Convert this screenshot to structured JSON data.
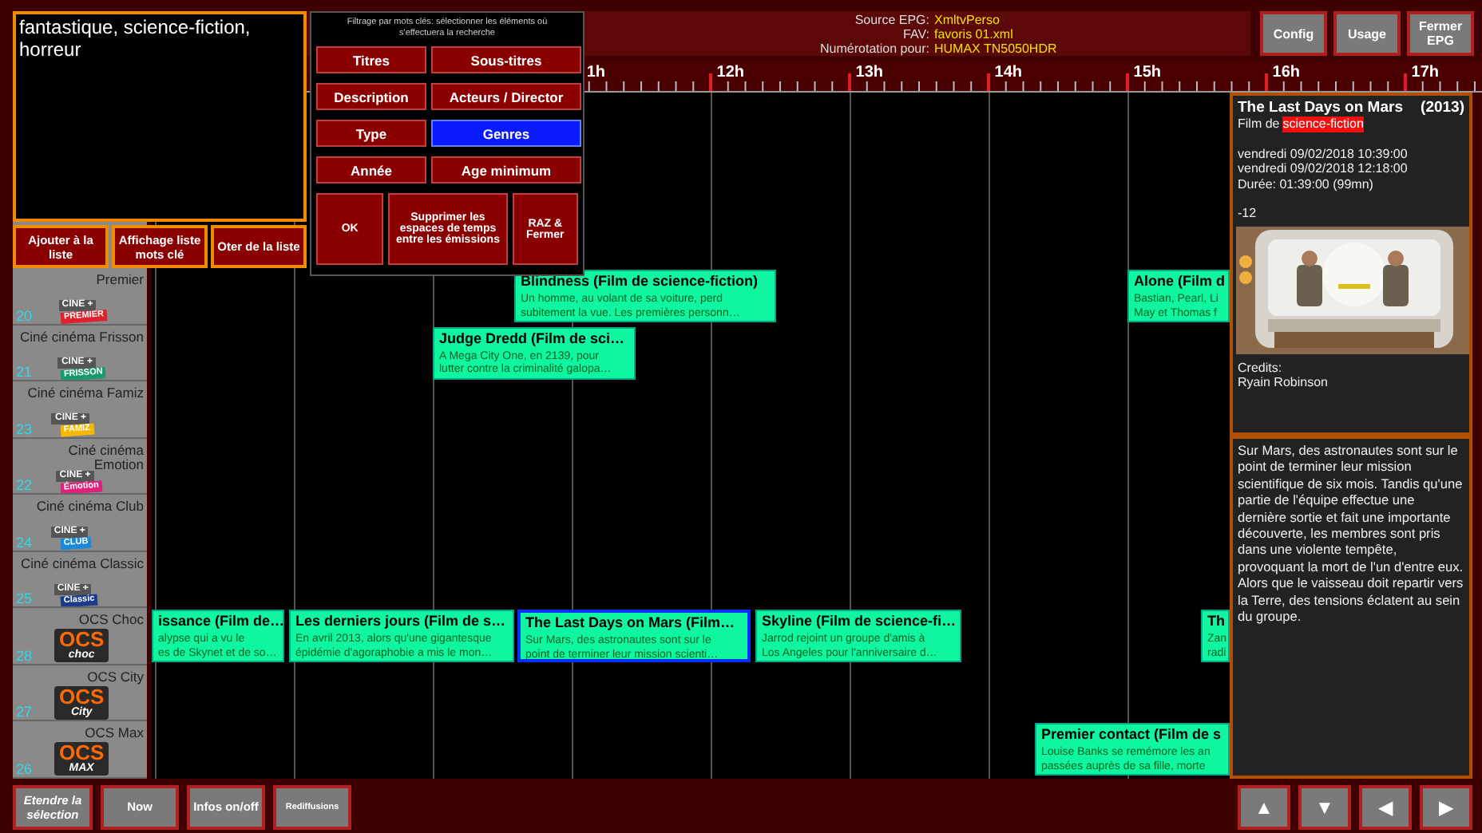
{
  "header": {
    "info": [
      {
        "label": "Source EPG:",
        "value": "XmltvPerso"
      },
      {
        "label": "FAV:",
        "value": "favoris 01.xml"
      },
      {
        "label": "Numérotation pour:",
        "value": "HUMAX TN5050HDR"
      }
    ],
    "buttons": [
      "Config",
      "Usage",
      "Fermer EPG"
    ]
  },
  "keyword_panel": {
    "text": "fantastique, science-fiction, horreur",
    "buttons": [
      "Ajouter à la liste",
      "Affichage liste mots clé",
      "Oter de la liste"
    ]
  },
  "filter_popup": {
    "title": "Filtrage par mots clés: sélectionner les éléments où s'effectuera la recherche",
    "fields": [
      {
        "label": "Titres",
        "selected": false
      },
      {
        "label": "Sous-titres",
        "selected": false
      },
      {
        "label": "Description",
        "selected": false
      },
      {
        "label": "Acteurs / Director",
        "selected": false
      },
      {
        "label": "Type",
        "selected": false
      },
      {
        "label": "Genres",
        "selected": true
      },
      {
        "label": "Année",
        "selected": false
      },
      {
        "label": "Age minimum",
        "selected": false
      }
    ],
    "actions": [
      "OK",
      "Supprimer les espaces de temps entre les émissions",
      "RAZ & Fermer"
    ]
  },
  "timeline": {
    "hours": [
      "1h",
      "12h",
      "13h",
      "14h",
      "15h",
      "16h",
      "17h"
    ]
  },
  "channels": [
    {
      "name": "Premier",
      "number": "20",
      "logo": {
        "kind": "cine",
        "top": "CINE +",
        "tag": "PREMIER",
        "color": "#e0202a"
      },
      "programs": [
        {
          "title": "Blindness (Film de science-fiction)",
          "description": "Un homme, au volant de sa voiture, perd\nsubitement la vue. Les premières personn…",
          "selected": false
        },
        {
          "title": "Alone (Film d",
          "description": "Bastian, Pearl, Li\nMay et Thomas f",
          "selected": false
        }
      ]
    },
    {
      "name": "Ciné cinéma Frisson",
      "number": "21",
      "logo": {
        "kind": "cine",
        "top": "CINE +",
        "tag": "FRISSON",
        "color": "#1a9a6a"
      },
      "programs": [
        {
          "title": "Judge Dredd (Film de sci…",
          "description": "A Mega City One, en 2139, pour\nlutter contre la criminalité galopa…",
          "selected": false
        }
      ]
    },
    {
      "name": "Ciné cinéma Famiz",
      "number": "23",
      "logo": {
        "kind": "cine",
        "top": "CINE +",
        "tag": "FAMIZ",
        "color": "#f5b800"
      }
    },
    {
      "name": "Ciné cinéma Emotion",
      "number": "22",
      "logo": {
        "kind": "cine",
        "top": "CINE +",
        "tag": "Émotion",
        "color": "#e0207a"
      }
    },
    {
      "name": "Ciné cinéma Club",
      "number": "24",
      "logo": {
        "kind": "cine",
        "top": "CINE +",
        "tag": "CLUB",
        "color": "#1a8ad8"
      }
    },
    {
      "name": "Ciné cinéma Classic",
      "number": "25",
      "logo": {
        "kind": "cine",
        "top": "CINE +",
        "tag": "Classic",
        "color": "#1a3a8a"
      }
    },
    {
      "name": "OCS Choc",
      "number": "28",
      "logo": {
        "kind": "ocs",
        "top": "OCS",
        "tag": "choc",
        "color": "#ff6a00"
      },
      "programs": [
        {
          "title": "issance (Film de…",
          "description": "alypse qui a vu le\nes de Skynet et de so…",
          "selected": false
        },
        {
          "title": "Les derniers jours (Film de s…",
          "description": "En avril 2013, alors qu'une gigantesque\népidémie d'agoraphobie a mis le mon…",
          "selected": false
        },
        {
          "title": "The Last Days on Mars (Film…",
          "description": "Sur Mars, des astronautes sont sur le\npoint de terminer leur mission scienti…",
          "selected": true
        },
        {
          "title": "Skyline (Film de science-fi…",
          "description": "Jarrod rejoint un groupe d'amis à\nLos Angeles pour l'anniversaire d…",
          "selected": false
        },
        {
          "title": "Th",
          "description": "Zan\nradi",
          "selected": false
        }
      ]
    },
    {
      "name": "OCS City",
      "number": "27",
      "logo": {
        "kind": "ocs",
        "top": "OCS",
        "tag": "City",
        "color": "#ff6a00"
      }
    },
    {
      "name": "OCS Max",
      "number": "26",
      "logo": {
        "kind": "ocs",
        "top": "OCS",
        "tag": "MAX",
        "color": "#ff6a00"
      },
      "programs": [
        {
          "title": "Premier contact (Film de s",
          "description": "Louise Banks se remémore les an\npassées auprès de sa fille, morte",
          "selected": false
        }
      ]
    }
  ],
  "info_panel": {
    "title": "The Last Days on Mars",
    "year": "(2013)",
    "genre_prefix": "Film de",
    "genre": "science-fiction",
    "schedule": [
      "vendredi 09/02/2018 10:39:00",
      "vendredi 09/02/2018 12:18:00",
      "Durée: 01:39:00 (99mn)"
    ],
    "rating": "-12",
    "picture": {
      "kind": "picture"
    },
    "credits_label": "Credits:",
    "credits": "Ryain Robinson",
    "synopsis": "Sur Mars, des astronautes sont sur le point de terminer leur mission scientifique de six mois. Tandis qu'une partie de l'équipe effectue une dernière sortie et fait une importante découverte, les membres sont pris dans une violente tempête, provoquant la mort de l'un d'entre eux. Alors que le vaisseau doit repartir vers la Terre, des tensions éclatent au sein du groupe."
  },
  "bottom_bar": {
    "buttons": [
      {
        "label": "Etendre la sélection",
        "kind": "italic"
      },
      {
        "label": "Now",
        "kind": "normal"
      },
      {
        "label": "Infos on/off",
        "kind": "normal"
      },
      {
        "label": "Rediffusions",
        "kind": "small"
      }
    ],
    "nav": [
      "▲",
      "▼",
      "◀",
      "▶"
    ]
  }
}
